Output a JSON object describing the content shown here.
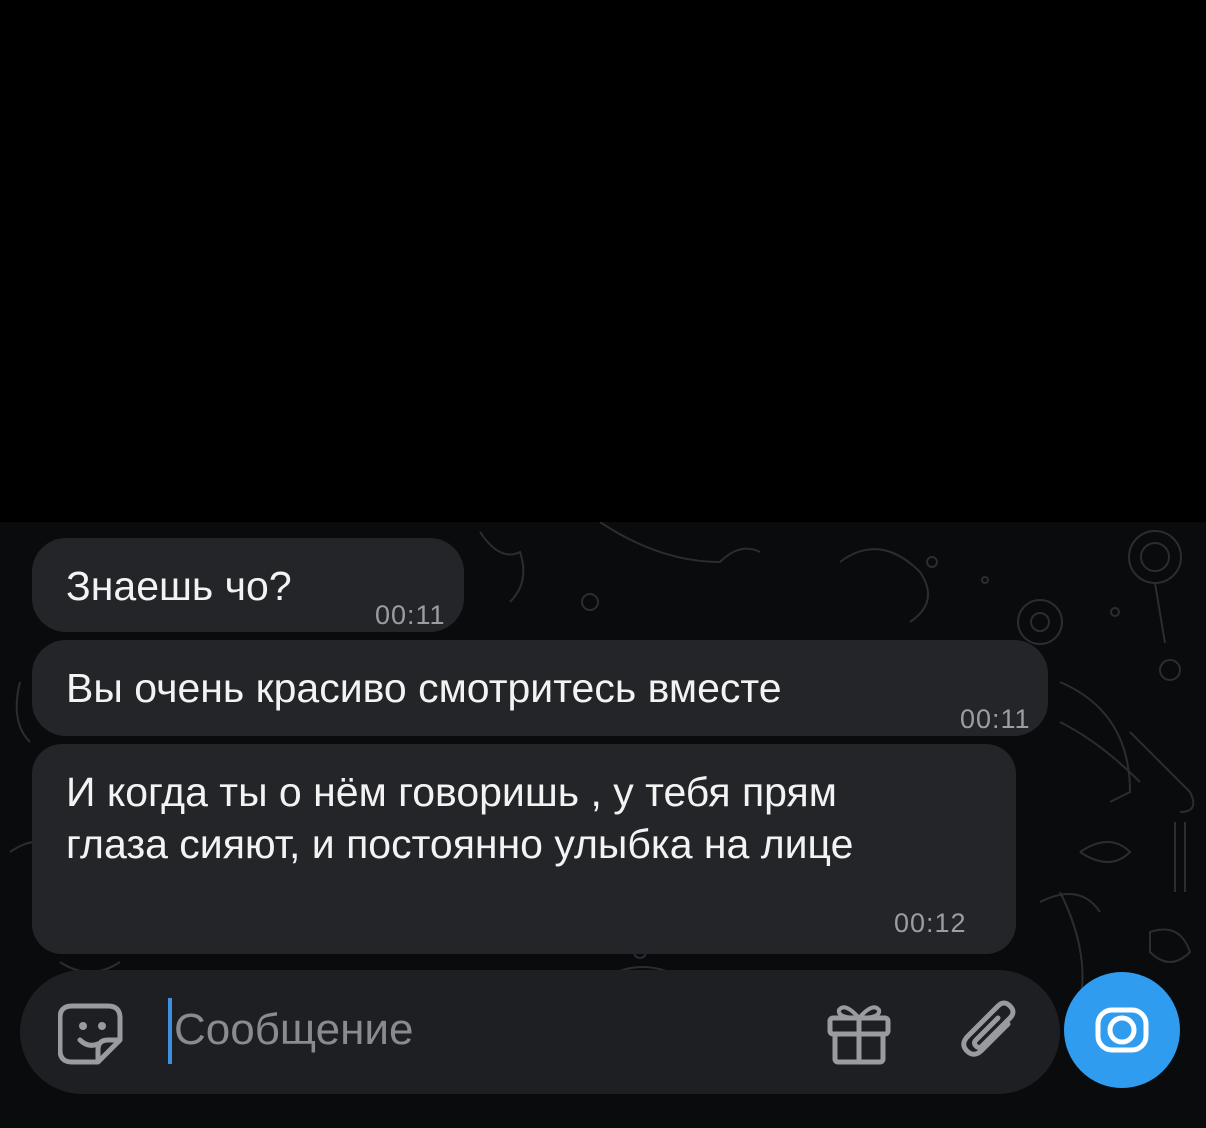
{
  "messages": [
    {
      "text": "Знаешь чо?",
      "time": "00:11"
    },
    {
      "text": "Вы очень красиво смотритесь вместе",
      "time": "00:11"
    },
    {
      "text": "И когда ты о нём говоришь , у тебя прям\nглаза сияют, и постоянно улыбка на лице",
      "time": "00:12"
    }
  ],
  "composer": {
    "placeholder": "Сообщение",
    "value": ""
  },
  "icons": {
    "sticker": "sticker-smile-icon",
    "gift": "gift-icon",
    "attach": "paperclip-icon",
    "camera": "camera-record-icon"
  },
  "colors": {
    "background": "#000000",
    "bubble": "#242528",
    "accent": "#2f9cf0"
  }
}
